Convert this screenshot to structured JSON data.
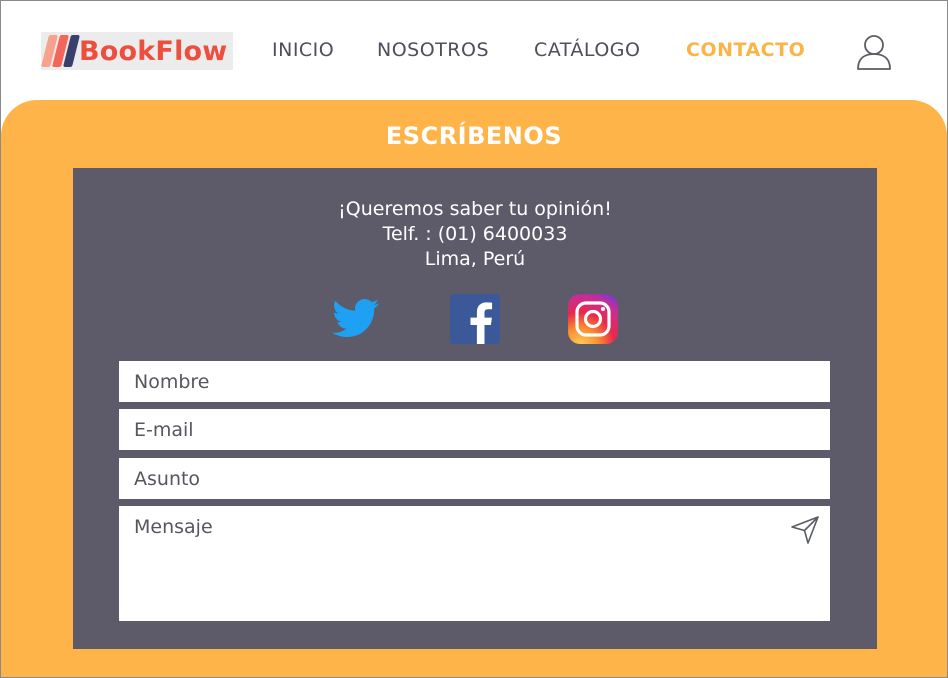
{
  "brand": {
    "name": "BookFlow",
    "colors": {
      "mark_light": "#f7a28c",
      "mark_mid": "#f3665a",
      "mark_dark": "#3b3f6b",
      "text": "#ec4f3e"
    }
  },
  "nav": {
    "items": [
      {
        "label": "INICIO",
        "active": false
      },
      {
        "label": "NOSOTROS",
        "active": false
      },
      {
        "label": "CATÁLOGO",
        "active": false
      },
      {
        "label": "CONTACTO",
        "active": true
      }
    ],
    "user_icon": "user-icon"
  },
  "contact": {
    "title": "ESCRÍBENOS",
    "lines": [
      "¡Queremos saber tu opinión!",
      "Telf. : (01) 6400033",
      "Lima, Perú"
    ],
    "social": [
      "twitter-icon",
      "facebook-icon",
      "instagram-icon"
    ]
  },
  "form": {
    "name_placeholder": "Nombre",
    "email_placeholder": "E-mail",
    "subject_placeholder": "Asunto",
    "message_placeholder": "Mensaje",
    "send_icon": "send-icon"
  },
  "colors": {
    "accent": "#feb448",
    "panel": "#5d5b6a",
    "nav_text": "#4d4f5c",
    "nav_active": "#fbb44a"
  }
}
